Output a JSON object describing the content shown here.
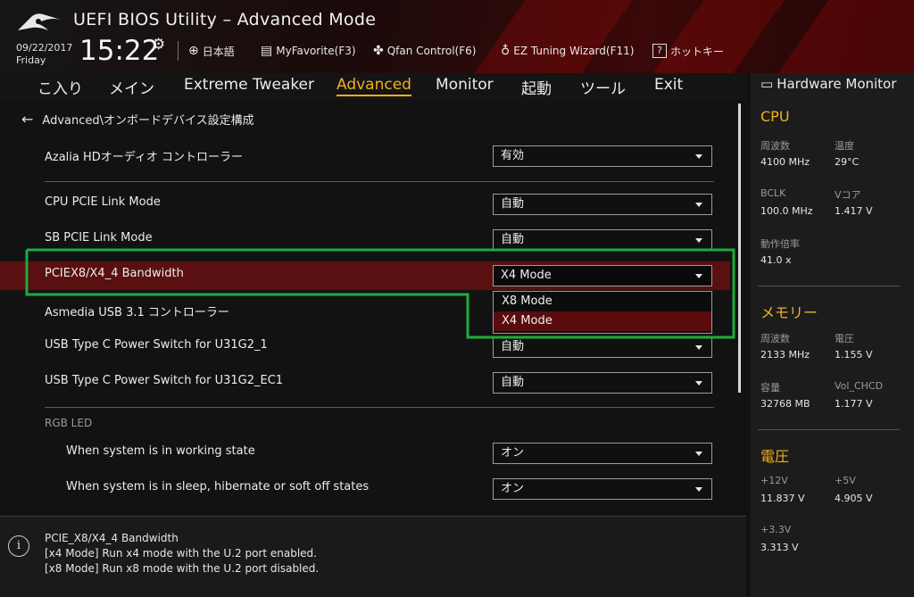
{
  "header": {
    "title": "UEFI BIOS Utility – Advanced Mode",
    "date": "09/22/2017",
    "day": "Friday",
    "time": "15:22",
    "buttons": [
      {
        "icon": "globe-icon",
        "label": "日本語"
      },
      {
        "icon": "favorite-icon",
        "label": "MyFavorite(F3)"
      },
      {
        "icon": "fan-icon",
        "label": "Qfan Control(F6)"
      },
      {
        "icon": "bulb-icon",
        "label": "EZ Tuning Wizard(F11)"
      },
      {
        "icon": "help-icon",
        "label": "ホットキー"
      }
    ]
  },
  "menu": {
    "items": [
      "こ入り",
      "メイン",
      "Extreme Tweaker",
      "Advanced",
      "Monitor",
      "起動",
      "ツール",
      "Exit"
    ],
    "active": "Advanced"
  },
  "breadcrumb": "Advanced\\オンボードデバイス設定構成",
  "settings": [
    {
      "label": "Azalia HDオーディオ コントローラー",
      "value": "有効"
    },
    {
      "label": "CPU PCIE Link Mode",
      "value": "自動"
    },
    {
      "label": "SB PCIE Link Mode",
      "value": "自動"
    },
    {
      "label": "PCIEX8/X4_4 Bandwidth",
      "value": "X4 Mode"
    },
    {
      "label": "Asmedia USB 3.1 コントローラー",
      "value": ""
    },
    {
      "label": "USB Type C Power Switch for U31G2_1",
      "value": "自動"
    },
    {
      "label": "USB Type C Power Switch for U31G2_EC1",
      "value": "自動"
    },
    {
      "label": "RGB LED",
      "value": ""
    },
    {
      "label": "When system is in working state",
      "value": "オン"
    },
    {
      "label": "When system is in sleep, hibernate or soft off states",
      "value": "オン"
    }
  ],
  "dropdown": {
    "options": [
      "X8 Mode",
      "X4 Mode"
    ],
    "selected": "X4 Mode"
  },
  "help": {
    "lines": [
      "PCIE_X8/X4_4 Bandwidth",
      "[x4 Mode] Run x4 mode with the U.2 port enabled.",
      "[x8 Mode] Run x8 mode with the U.2 port disabled."
    ]
  },
  "hardware_monitor": {
    "title": "Hardware Monitor",
    "cpu": {
      "heading": "CPU",
      "freq_label": "周波数",
      "freq": "4100 MHz",
      "temp_label": "温度",
      "temp": "29°C",
      "bclk_label": "BCLK",
      "bclk": "100.0 MHz",
      "vcore_label": "Vコア",
      "vcore": "1.417 V",
      "ratio_label": "動作倍率",
      "ratio": "41.0 x"
    },
    "memory": {
      "heading": "メモリー",
      "freq_label": "周波数",
      "freq": "2133 MHz",
      "volt_label": "電圧",
      "volt": "1.155 V",
      "cap_label": "容量",
      "cap": "32768 MB",
      "chcd_label": "Vol_CHCD",
      "chcd": "1.177 V"
    },
    "voltage": {
      "heading": "電圧",
      "v12_label": "+12V",
      "v12": "11.837 V",
      "v5_label": "+5V",
      "v5": "4.905 V",
      "v33_label": "+3.3V",
      "v33": "3.313 V"
    }
  },
  "colors": {
    "accent": "#f2b01d",
    "highlight_row": "#5a1010",
    "annotation_box": "#1fab3c"
  }
}
